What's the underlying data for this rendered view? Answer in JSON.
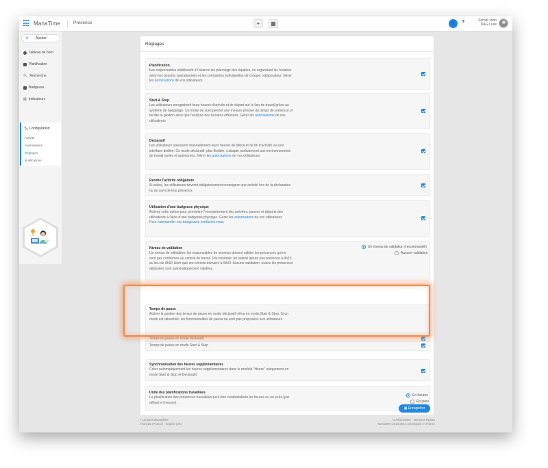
{
  "app": {
    "name": "ManaTime",
    "module": "Présence"
  },
  "topbar": {
    "plus_btn": "+",
    "cal_btn": "▦",
    "user_icon": "👤",
    "help": "?",
    "user_name": "Fornet John",
    "user_company": "D&G Luxe"
  },
  "sidebar": {
    "add_label": "Ajouter",
    "items": [
      {
        "label": "Tableau de bord",
        "icon": "dashboard-icon"
      },
      {
        "label": "Planification",
        "icon": "calendar-icon"
      },
      {
        "label": "Recherche",
        "icon": "search-icon"
      },
      {
        "label": "Badgeuse",
        "icon": "badge-icon"
      },
      {
        "label": "Indicateurs",
        "icon": "chart-icon"
      }
    ],
    "config": {
      "title": "Configuration",
      "subs": [
        "Activité",
        "Autorisations",
        "Réglages",
        "Notifications"
      ],
      "active_index": 2
    }
  },
  "main": {
    "title": "Réglages",
    "cards": [
      {
        "title": "Planification",
        "desc_pre": "Les responsables établissent à l'avance les plannings des équipes, en organisant les horaires selon les besoins opérationnels et les contraintes individuelles de chaque collaborateur. Gérer les ",
        "link": "autorisations",
        "desc_post": " de vos utilisateurs"
      },
      {
        "title": "Start & Stop",
        "desc_pre": "Les utilisateurs enregistrent leurs heures d'arrivée et de départ sur le lieu de travail grâce au système de badgeage. Ce mode de suivi permet une mesure précise du temps de présence et facilite la gestion ainsi que l'analyse des horaires effectués. Gérer les ",
        "link": "autorisations",
        "desc_post": " de vos utilisateurs"
      },
      {
        "title": "Déclaratif",
        "desc_pre": "Les utilisateurs saisissent manuellement leurs heures de début et de fin d'activité via une interface dédiée. Ce mode déclaratif, plus flexible, s'adapte parfaitement aux environnements de travail variés et autonomes. Gérer les ",
        "link": "autorisations",
        "desc_post": " de vos utilisateurs"
      },
      {
        "title": "Rendre l'activité obligatoire",
        "desc": "Si activé, les utilisateurs devront obligatoirement renseigner une activité lors de la déclaration ou du suivi de leur présence."
      },
      {
        "title": "Utilisation d'une badgeuse physique",
        "desc_pre": "Activez cette option pour permettre l'enregistrement des arrivées, pauses et départs des utilisateurs à l'aide d'une badgeuse physique. Gérer les ",
        "link": "autorisations",
        "desc_post": " de vos utilisateurs",
        "link2": "Pour commander vos badgeuses contactez-nous"
      },
      {
        "title": "Niveau de validation",
        "desc": "Un niveau de validation: les responsables de services doivent valider les présences qui ne sont pas conformes au contrat de travail. Par exemple: un salarié ajoute une présence à 9h15 au lieu de 8h00 alors que son contrat démarre à 9h00. Aucune validation: toutes les présences déposées sont automatiquement validées.",
        "options": [
          "Un niveau de validation (recommandé)",
          "Aucune validation"
        ]
      },
      {
        "title": "Temps de pause",
        "desc": "Activer la gestion des temps de pause en mode déclaratif et/ou en mode Start & Stop. Si un mode est désactivé, les fonctionnalités de pause ne sont pas proposées aux utilisateurs.",
        "subs": [
          "Temps de pause en mode déclaratif",
          "Temps de pause en mode Start & Stop"
        ]
      },
      {
        "title": "Synchronisation des heures supplémentaires",
        "desc": "Créer automatiquement les heures supplémentaires dans le module \"Heure\" uniquement en mode Start & Stop et Déclaratif."
      },
      {
        "title": "Unité des planifications travaillées",
        "desc": "La planification des présences travaillées peut être comptabilisée en heures ou en jours (par défaut en heures).",
        "options": [
          "En heures",
          "En jours"
        ]
      }
    ],
    "save_label": "Enregistrer"
  },
  "footer": {
    "left_1": "Langues disponibles",
    "left_2": "Français (France) · English (UK)",
    "right_1": "Confidentialité · Mentions légales",
    "right_2": "ManaGRH 2013-2024, Développé en France"
  },
  "colors": {
    "accent": "#1e88e5",
    "highlight": "#f08a4b"
  }
}
